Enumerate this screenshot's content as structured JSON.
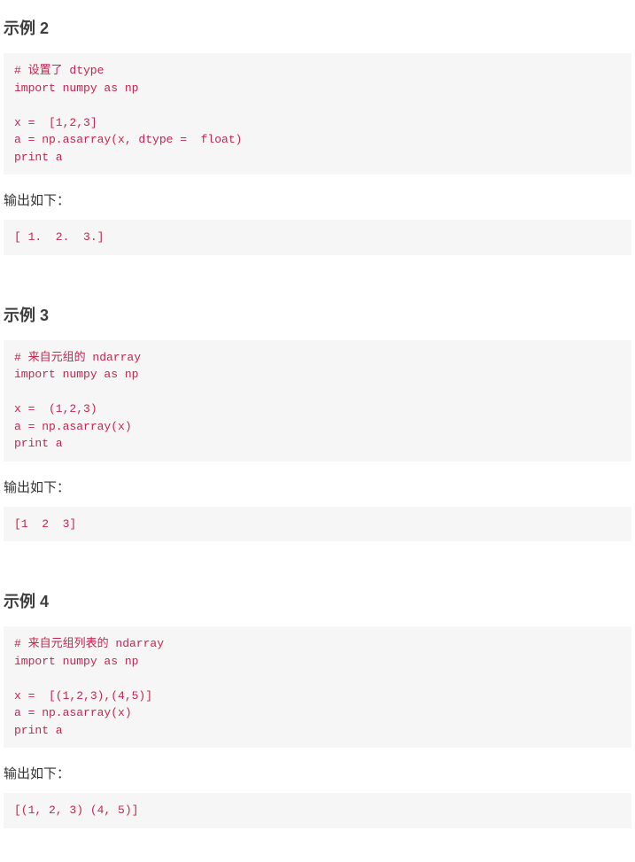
{
  "examples": [
    {
      "heading": "示例 2",
      "code": "# 设置了 dtype  \nimport numpy as np \n\nx =  [1,2,3] \na = np.asarray(x, dtype =  float)  \nprint a",
      "output_label": "输出如下：",
      "output": "[ 1.  2.  3.] "
    },
    {
      "heading": "示例 3",
      "code": "# 来自元组的 ndarray  \nimport numpy as np \n\nx =  (1,2,3) \na = np.asarray(x)  \nprint a",
      "output_label": "输出如下：",
      "output": "[1  2  3]"
    },
    {
      "heading": "示例 4",
      "code": "# 来自元组列表的 ndarray\nimport numpy as np \n\nx =  [(1,2,3),(4,5)] \na = np.asarray(x)  \nprint a",
      "output_label": "输出如下：",
      "output": "[(1, 2, 3) (4, 5)]"
    }
  ]
}
